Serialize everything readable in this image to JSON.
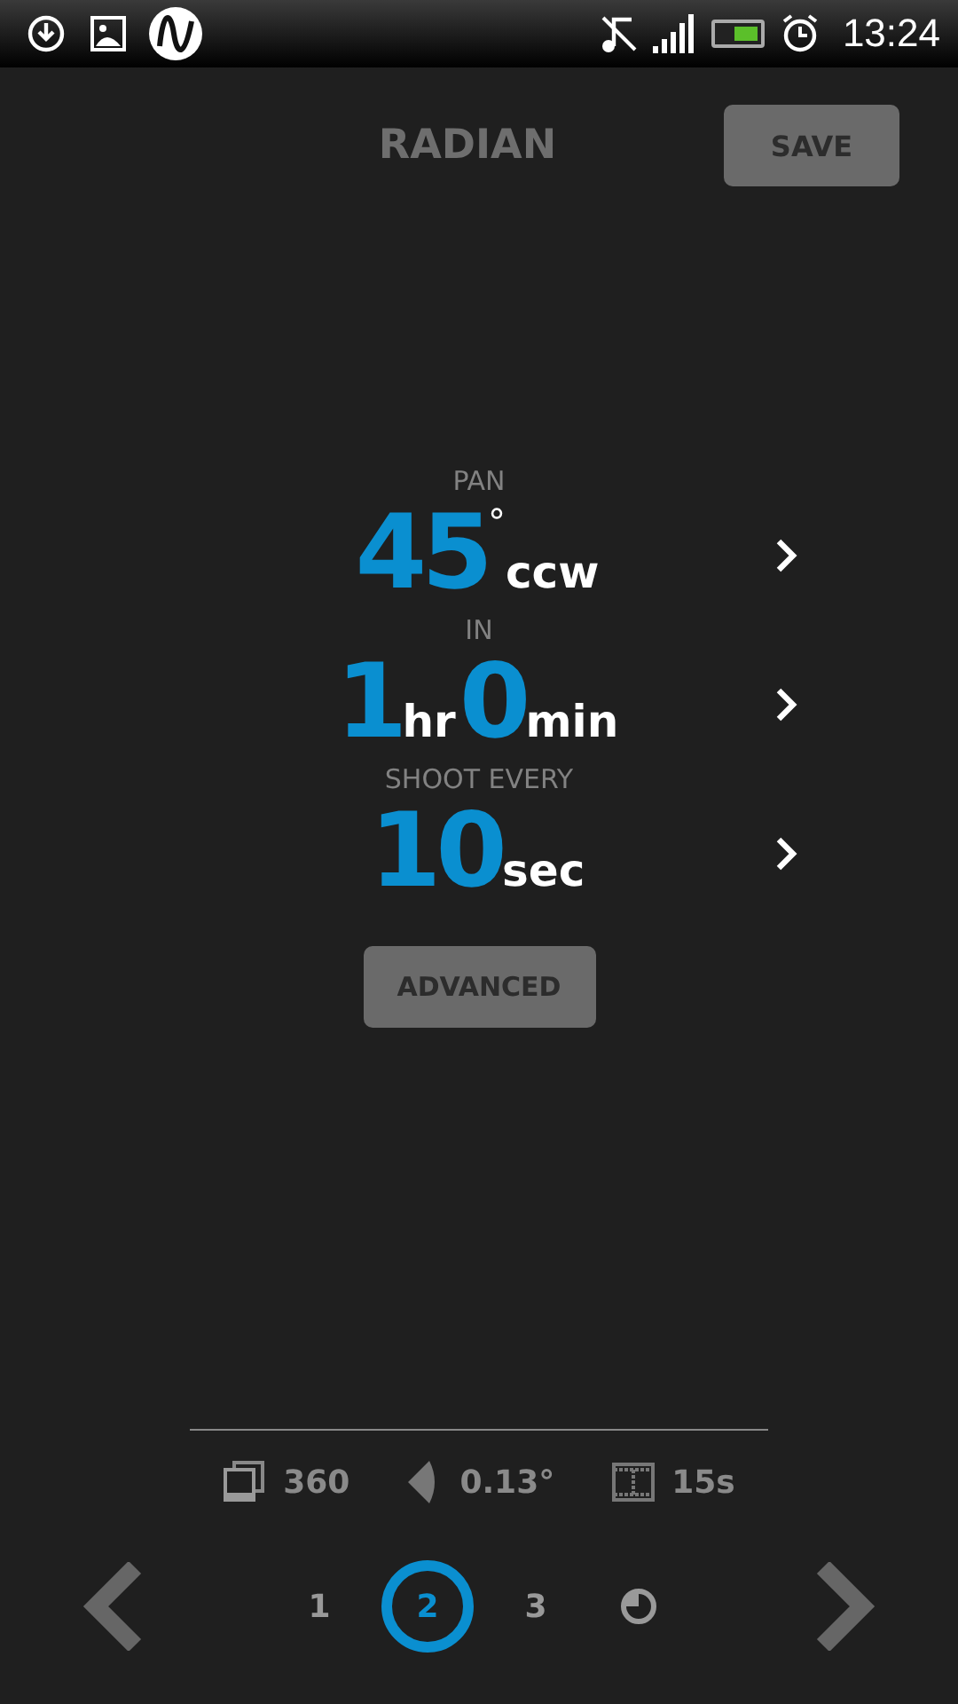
{
  "status_bar": {
    "time": "13:24"
  },
  "header": {
    "title": "RADIAN",
    "save_button": "SAVE"
  },
  "settings": [
    {
      "label": "PAN",
      "parts": [
        {
          "kind": "number",
          "text": "45"
        },
        {
          "kind": "sup",
          "text": "°"
        },
        {
          "kind": "unit",
          "text": "ccw"
        }
      ]
    },
    {
      "label": "IN",
      "parts": [
        {
          "kind": "number",
          "text": "1"
        },
        {
          "kind": "unit",
          "text": "hr"
        },
        {
          "kind": "number",
          "text": "0"
        },
        {
          "kind": "unit",
          "text": "min"
        }
      ]
    },
    {
      "label": "SHOOT EVERY",
      "parts": [
        {
          "kind": "number",
          "text": "10"
        },
        {
          "kind": "unit",
          "text": "sec"
        }
      ]
    }
  ],
  "advanced_button": "ADVANCED",
  "stats": [
    {
      "kind": "photos",
      "text": "360"
    },
    {
      "kind": "angle",
      "text": "0.13°"
    },
    {
      "kind": "film",
      "text": "15s"
    }
  ],
  "steps": [
    {
      "kind": "number",
      "text": "1",
      "selected": false
    },
    {
      "kind": "number",
      "text": "2",
      "selected": true
    },
    {
      "kind": "number",
      "text": "3",
      "selected": false
    },
    {
      "kind": "review",
      "selected": false
    }
  ]
}
